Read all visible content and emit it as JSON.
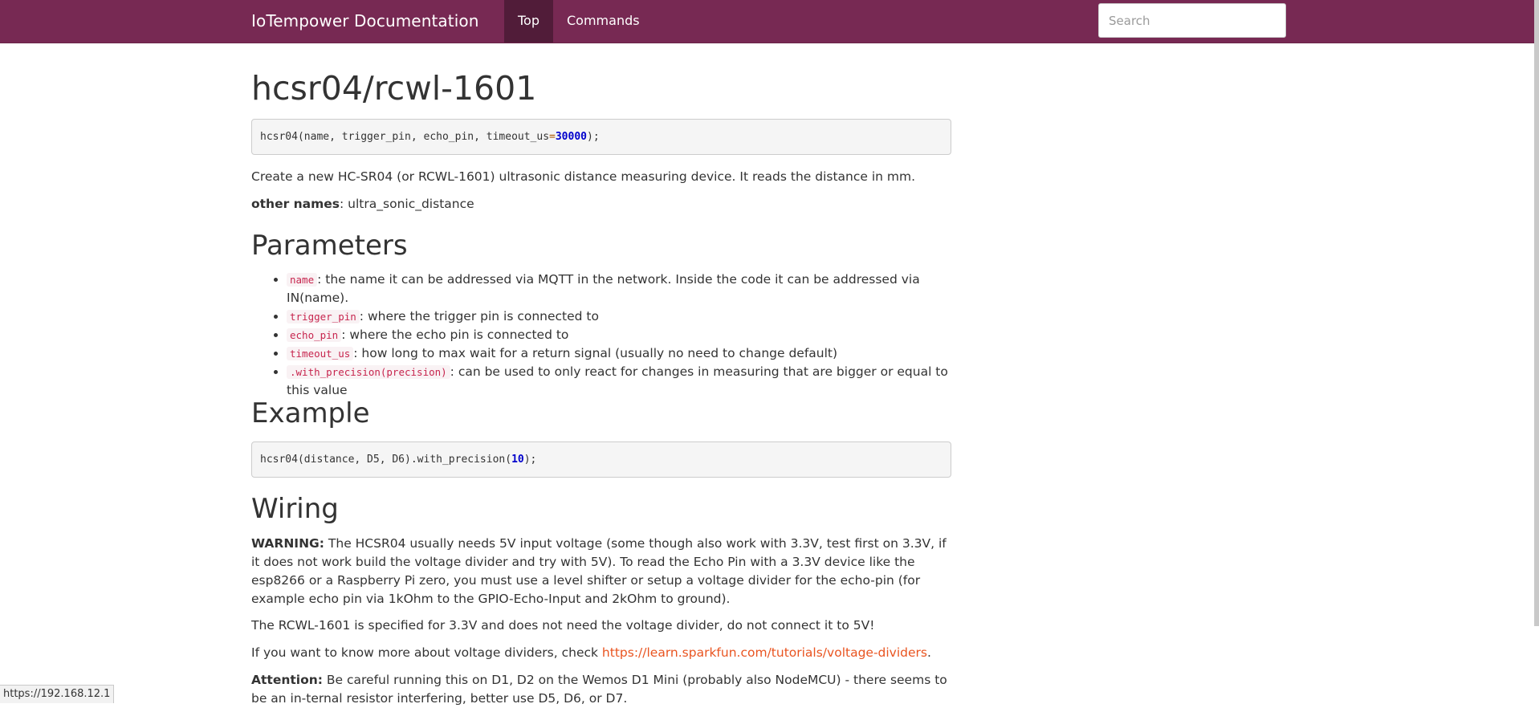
{
  "navbar": {
    "brand": "IoTempower Documentation",
    "links": [
      {
        "label": "Top",
        "active": true
      },
      {
        "label": "Commands",
        "active": false
      }
    ],
    "search_placeholder": "Search"
  },
  "page": {
    "title": "hcsr04/rcwl-1601",
    "signature": {
      "pre": "hcsr04(name, trigger_pin, echo_pin, timeout_us",
      "op": "=",
      "num": "30000",
      "post": ");"
    },
    "description": "Create a new HC-SR04 (or RCWL-1601) ultrasonic distance measuring device. It reads the distance in mm.",
    "other_names_label": "other names",
    "other_names_value": ": ultra_sonic_distance"
  },
  "parameters": {
    "heading": "Parameters",
    "items": [
      {
        "code": "name",
        "text": ": the name it can be addressed via MQTT in the network. Inside the code it can be addressed via IN(name)."
      },
      {
        "code": "trigger_pin",
        "text": ": where the trigger pin is connected to"
      },
      {
        "code": "echo_pin",
        "text": ": where the echo pin is connected to"
      },
      {
        "code": "timeout_us",
        "text": ": how long to max wait for a return signal (usually no need to change default)"
      },
      {
        "code": ".with_precision(precision)",
        "text": ": can be used to only react for changes in measuring that are bigger or equal to this value"
      }
    ]
  },
  "example": {
    "heading": "Example",
    "code_pre": "hcsr04(distance, D5, D6).with_precision(",
    "code_num": "10",
    "code_post": ");"
  },
  "wiring": {
    "heading": "Wiring",
    "warning_label": "WARNING:",
    "warning_text": " The HCSR04 usually needs 5V input voltage (some though also work with 3.3V, test first on 3.3V, if it does not work build the voltage divider and try with 5V). To read the Echo Pin with a 3.3V device like the esp8266 or a Raspberry Pi zero, you must use a level shifter or setup a voltage divider for the echo-pin (for example echo pin via 1kOhm to the GPIO-Echo-Input and 2kOhm to ground).",
    "rcwl_text": "The RCWL-1601 is specified for 3.3V and does not need the voltage divider, do not connect it to 5V!",
    "divider_text": "If you want to know more about voltage dividers, check ",
    "divider_link": "https://learn.sparkfun.com/tutorials/voltage-dividers",
    "divider_end": ".",
    "attention_label": "Attention:",
    "attention_text": " Be careful running this on D1, D2 on the Wemos D1 Mini (probably also NodeMCU) - there seems to be an in-ternal resistor interfering, better use D5, D6, or D7."
  },
  "status_url": "https://192.168.12.1",
  "colors": {
    "navbar": "#772953",
    "nav_active": "#511c39",
    "link": "#e95420",
    "inline_code": "#c7254e"
  }
}
